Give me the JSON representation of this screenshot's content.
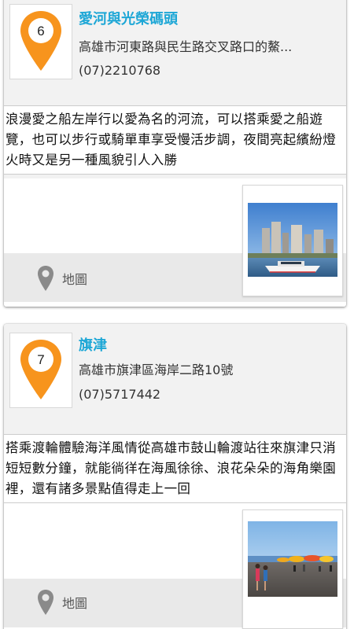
{
  "places": [
    {
      "number": "6",
      "title": "愛河與光榮碼頭",
      "address": "高雄市河東路與民生路交叉路口的鰲...",
      "phone": "(07)2210768",
      "description": "浪漫愛之船左岸行以愛為名的河流，可以搭乘愛之船遊覽，也可以步行或騎單車享受慢活步調，夜間亮起繽紛燈火時又是另一種風貌引人入勝",
      "map_label": "地圖"
    },
    {
      "number": "7",
      "title": "旗津",
      "address": "高雄市旗津區海岸二路10號",
      "phone": "(07)5717442",
      "description": "搭乘渡輪體驗海洋風情從高雄市鼓山輪渡站往來旗津只消短短數分鐘，就能徜徉在海風徐徐、浪花朵朵的海角樂園裡，還有諸多景點值得走上一回",
      "map_label": "地圖"
    }
  ],
  "colors": {
    "pin": "#f7941d",
    "title": "#1ea7d6",
    "map_icon": "#8a8a8a"
  }
}
